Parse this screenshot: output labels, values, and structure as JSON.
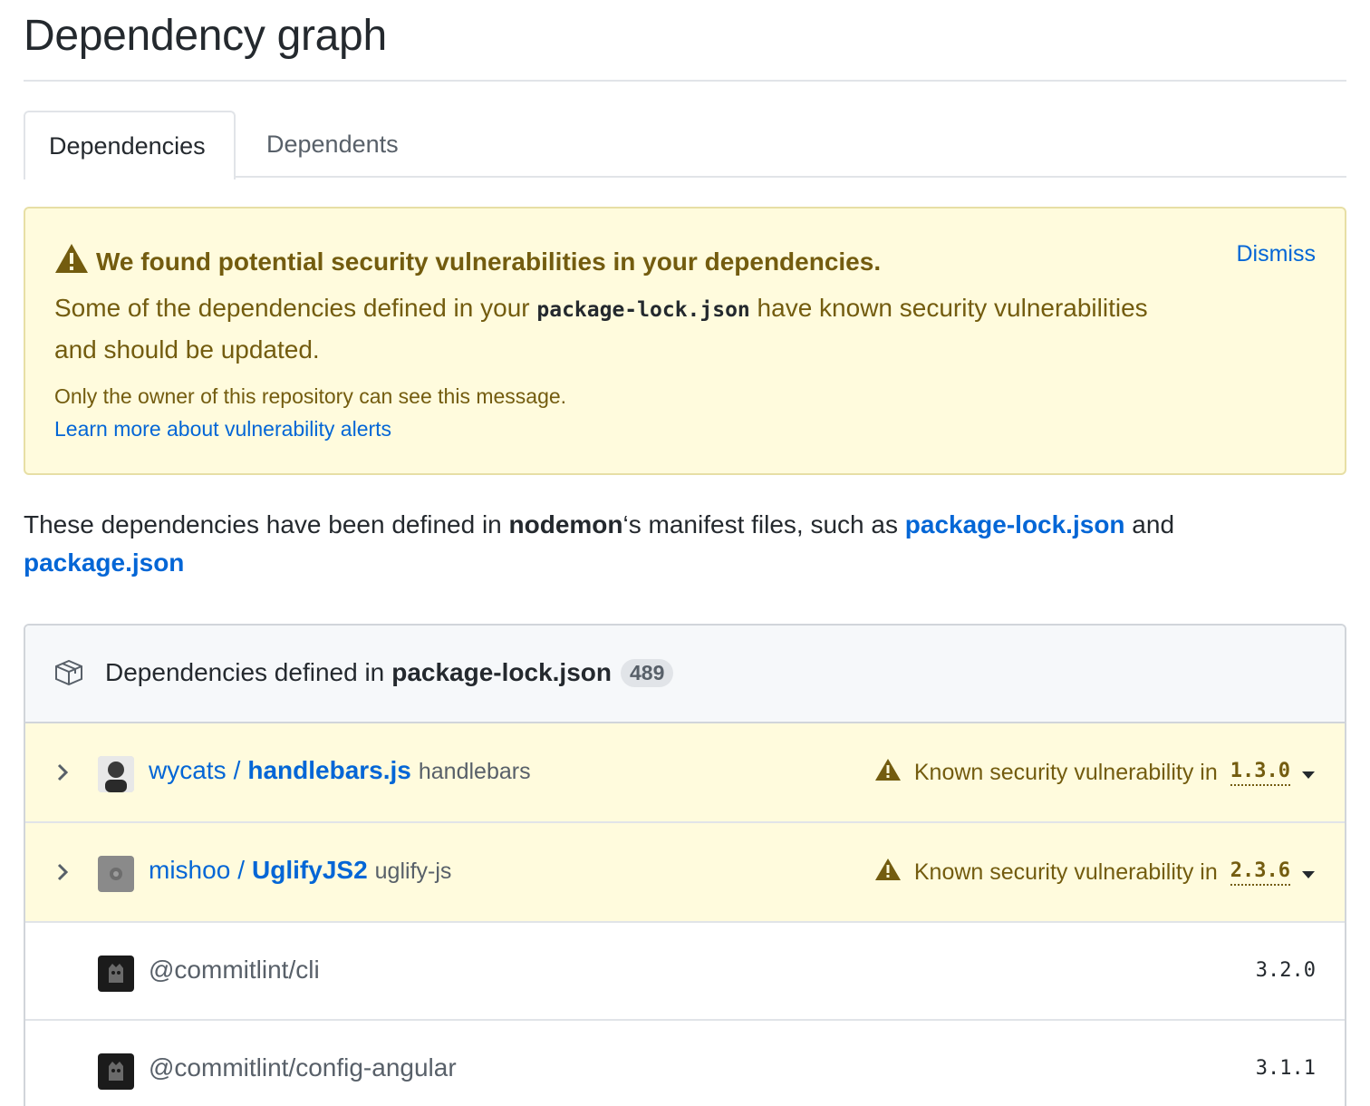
{
  "page": {
    "title": "Dependency graph"
  },
  "tabs": [
    {
      "label": "Dependencies",
      "selected": true
    },
    {
      "label": "Dependents",
      "selected": false
    }
  ],
  "alert": {
    "heading": "We found potential security vulnerabilities in your dependencies.",
    "dismiss_label": "Dismiss",
    "body_before": "Some of the dependencies defined in your ",
    "body_code": "package-lock.json",
    "body_after": " have known security vulnerabilities and should be updated.",
    "note": "Only the owner of this repository can see this message.",
    "learn_more": "Learn more about vulnerability alerts",
    "icon": "alert-triangle-icon"
  },
  "intro": {
    "before": "These dependencies have been defined in ",
    "repo": "nodemon",
    "middle": "‘s manifest files, such as ",
    "link1": "package-lock.json",
    "and": " and",
    "link2": "package.json"
  },
  "box": {
    "header_prefix": "Dependencies defined in",
    "header_file": "package-lock.json",
    "count": "489",
    "icon": "package-icon",
    "rows": [
      {
        "owner": "wycats",
        "separator": "/",
        "repo": "handlebars.js",
        "package": "handlebars",
        "vuln_label": "Known security vulnerability in",
        "version": "1.3.0",
        "avatar_color": "#3a3a3a"
      },
      {
        "owner": "mishoo",
        "separator": "/",
        "repo": "UglifyJS2",
        "package": "uglify-js",
        "vuln_label": "Known security vulnerability in",
        "version": "2.3.6",
        "avatar_color": "#8a8a8a"
      },
      {
        "name": "@commitlint/cli",
        "version": "3.2.0",
        "avatar_color": "#1b1b1b"
      },
      {
        "name": "@commitlint/config-angular",
        "version": "3.1.1",
        "avatar_color": "#1b1b1b"
      }
    ]
  },
  "colors": {
    "link": "#0366d6",
    "warning_bg": "#fffbdd",
    "warning_text": "#735c0f",
    "border": "#e1e4e8"
  }
}
